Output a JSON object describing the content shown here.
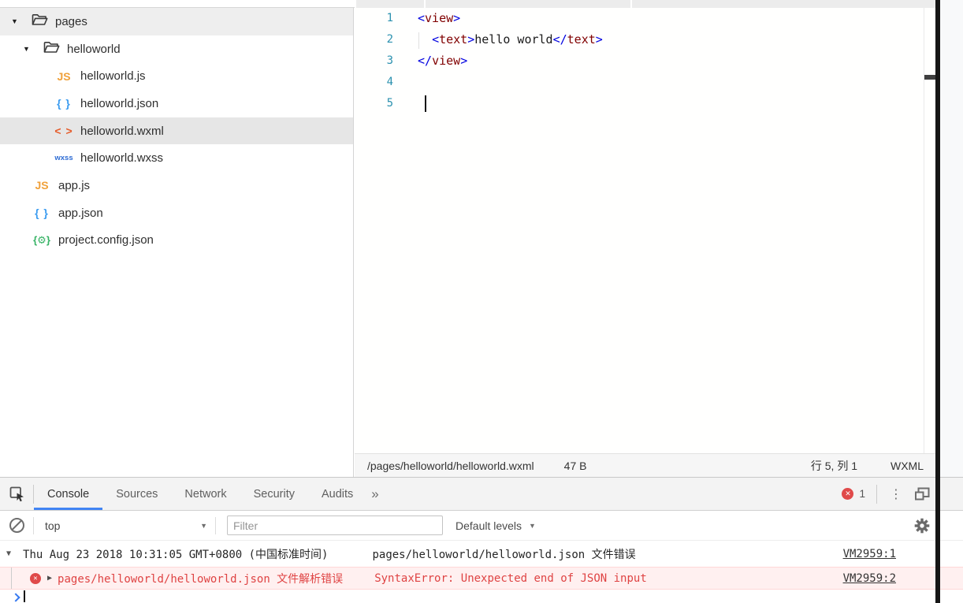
{
  "colors": {
    "accent_blue": "#4285f4",
    "error_red": "#df4343",
    "error_row_bg": "#fff0f0",
    "error_row_border": "#ffd7d7",
    "tag_name": "#800000",
    "tag_punct": "#0000e0",
    "line_number": "#2b91af",
    "js_icon": "#f0a13a",
    "json_icon": "#3c9cf0",
    "wxml_icon": "#e55c2b",
    "wxss_icon": "#2e6cd4",
    "config_icon": "#35b264",
    "prompt_blue": "#3679f0"
  },
  "sidebar": {
    "tree": [
      {
        "name": "pages",
        "type": "folder",
        "expanded": true
      },
      {
        "name": "helloworld",
        "type": "folder",
        "expanded": true
      },
      {
        "name": "helloworld.js",
        "badge": "JS"
      },
      {
        "name": "helloworld.json",
        "badge": "{ }"
      },
      {
        "name": "helloworld.wxml",
        "badge": "< >",
        "selected": true
      },
      {
        "name": "helloworld.wxss",
        "badge": "wxss"
      },
      {
        "name": "app.js",
        "badge": "JS"
      },
      {
        "name": "app.json",
        "badge": "{ }"
      },
      {
        "name": "project.config.json",
        "badge": "{⚙}"
      }
    ]
  },
  "editor": {
    "line_numbers": [
      "1",
      "2",
      "3",
      "4",
      "5"
    ],
    "code": {
      "l1_open": "<",
      "l1_tag": "view",
      "l1_close": ">",
      "l2_indent": "  ",
      "l2_open": "<",
      "l2_tag": "text",
      "l2_close": ">",
      "l2_text": "hello world",
      "l2_close_open": "</",
      "l2_close_tag": "text",
      "l2_close_close": ">",
      "l3_open": "</",
      "l3_tag": "view",
      "l3_close": ">"
    },
    "status_bar": {
      "path": "/pages/helloworld/helloworld.wxml",
      "file_size": "47 B",
      "cursor_position": "行 5, 列 1",
      "language": "WXML"
    }
  },
  "devtools": {
    "tabs": [
      {
        "label": "Console",
        "active": true
      },
      {
        "label": "Sources"
      },
      {
        "label": "Network"
      },
      {
        "label": "Security"
      },
      {
        "label": "Audits"
      }
    ],
    "more_tabs_glyph": "»",
    "error_count": "1",
    "filter_bar": {
      "context": "top",
      "filter_placeholder": "Filter",
      "levels": "Default levels"
    },
    "messages": [
      {
        "level": "log",
        "timestamp": "Thu Aug 23 2018 10:31:05 GMT+0800 (中国标准时间)",
        "text": "pages/helloworld/helloworld.json 文件错误",
        "source": "VM2959:1"
      },
      {
        "level": "error",
        "text": "pages/helloworld/helloworld.json 文件解析错误",
        "detail": "SyntaxError: Unexpected end of JSON input",
        "source": "VM2959:2"
      }
    ]
  }
}
